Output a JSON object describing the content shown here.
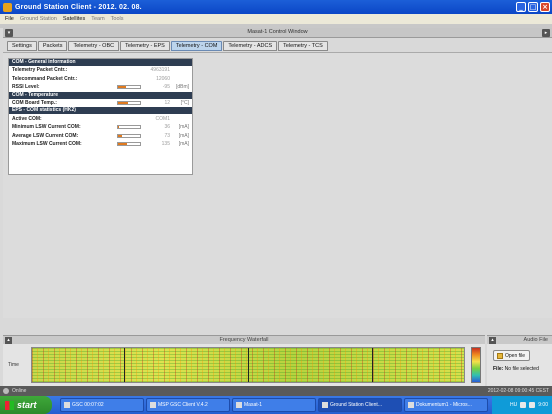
{
  "window": {
    "title": "Ground Station Client - 2012. 02. 08."
  },
  "menu": [
    {
      "label": "File",
      "enabled": true
    },
    {
      "label": "Ground Station",
      "enabled": false
    },
    {
      "label": "Satellites",
      "enabled": true
    },
    {
      "label": "Team",
      "enabled": false
    },
    {
      "label": "Tools",
      "enabled": false
    }
  ],
  "control_window": {
    "title": "Masat-1 Control Window"
  },
  "tabs": [
    {
      "label": "Settings",
      "active": false
    },
    {
      "label": "Packets",
      "active": false
    },
    {
      "label": "Telemetry - OBC",
      "active": false
    },
    {
      "label": "Telemetry - EPS",
      "active": false
    },
    {
      "label": "Telemetry - COM",
      "active": true
    },
    {
      "label": "Telemetry - ADCS",
      "active": false
    },
    {
      "label": "Telemetry - TCS",
      "active": false
    }
  ],
  "sections": {
    "general": {
      "header": "COM - General information",
      "rows": [
        {
          "label": "Telemetry Packet Cntr.:",
          "value": "4963191",
          "unit": "",
          "bar": null
        },
        {
          "label": "Telecommand Packet Cntr.:",
          "value": "12060",
          "unit": "",
          "bar": null
        },
        {
          "label": "RSSI Level:",
          "value": "-95",
          "unit": "[dBm]",
          "bar": 0.35
        }
      ]
    },
    "temperature": {
      "header": "COM - Temperature",
      "rows": [
        {
          "label": "COM Board Temp.:",
          "value": "12",
          "unit": "[°C]",
          "bar": 0.45
        }
      ]
    },
    "eps": {
      "header": "EPS - COM statistics (HK2)",
      "rows": [
        {
          "label": "Active COM:",
          "value": "COM1",
          "unit": "",
          "bar": null
        },
        {
          "label": "Minimum LSW Current COM:",
          "value": "36",
          "unit": "[mA]",
          "bar": 0.06
        },
        {
          "label": "Average LSW Current COM:",
          "value": "73",
          "unit": "[mA]",
          "bar": 0.2
        },
        {
          "label": "Maximum LSW Current COM:",
          "value": "135",
          "unit": "[mA]",
          "bar": 0.42
        }
      ]
    }
  },
  "waterfall": {
    "title": "Frequency Waterfall",
    "axis_label": "Time"
  },
  "audio": {
    "title": "Audio File",
    "open_label": "Open file",
    "file_label": "File:",
    "file_value": "No file selected"
  },
  "statusbar": {
    "left": "Online",
    "right": "2012-02-08 09:00:45 CEST"
  },
  "taskbar": {
    "start": "start",
    "tasks": [
      {
        "label": "GSC 00:07:02",
        "active": false
      },
      {
        "label": "MSP GSC Client V.4.2",
        "active": false
      },
      {
        "label": "Masat-1",
        "active": false
      },
      {
        "label": "Ground Station Client...",
        "active": true
      },
      {
        "label": "Dokumentum1 - Micros...",
        "active": false
      }
    ],
    "tray_lang": "HU",
    "clock": "9:00"
  },
  "colors": {
    "accent_orange": "#e07a1f",
    "section_header": "#2e3d52",
    "titlebar": "#1c5fd8"
  }
}
